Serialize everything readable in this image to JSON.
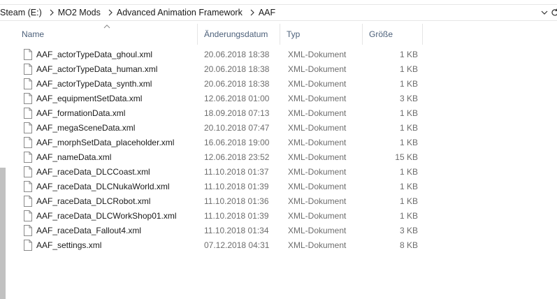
{
  "address_bar": {
    "breadcrumbs": [
      "Steam (E:)",
      "MO2 Mods",
      "Advanced Animation Framework",
      "AAF"
    ],
    "separator_icon": "chevron-right-icon",
    "dropdown_icon": "chevron-down-icon",
    "refresh_icon": "refresh-icon"
  },
  "columns": {
    "name": "Name",
    "date": "Änderungsdatum",
    "type": "Typ",
    "size": "Größe",
    "sort_indicator": "sort-ascending-icon"
  },
  "files": [
    {
      "name": "AAF_actorTypeData_ghoul.xml",
      "date": "20.06.2018 18:38",
      "type": "XML-Dokument",
      "size": "1 KB"
    },
    {
      "name": "AAF_actorTypeData_human.xml",
      "date": "20.06.2018 18:38",
      "type": "XML-Dokument",
      "size": "1 KB"
    },
    {
      "name": "AAF_actorTypeData_synth.xml",
      "date": "20.06.2018 18:38",
      "type": "XML-Dokument",
      "size": "1 KB"
    },
    {
      "name": "AAF_equipmentSetData.xml",
      "date": "12.06.2018 01:00",
      "type": "XML-Dokument",
      "size": "3 KB"
    },
    {
      "name": "AAF_formationData.xml",
      "date": "18.09.2018 07:13",
      "type": "XML-Dokument",
      "size": "1 KB"
    },
    {
      "name": "AAF_megaSceneData.xml",
      "date": "20.10.2018 07:47",
      "type": "XML-Dokument",
      "size": "1 KB"
    },
    {
      "name": "AAF_morphSetData_placeholder.xml",
      "date": "16.06.2018 19:00",
      "type": "XML-Dokument",
      "size": "1 KB"
    },
    {
      "name": "AAF_nameData.xml",
      "date": "12.06.2018 23:52",
      "type": "XML-Dokument",
      "size": "15 KB"
    },
    {
      "name": "AAF_raceData_DLCCoast.xml",
      "date": "11.10.2018 01:37",
      "type": "XML-Dokument",
      "size": "1 KB"
    },
    {
      "name": "AAF_raceData_DLCNukaWorld.xml",
      "date": "11.10.2018 01:39",
      "type": "XML-Dokument",
      "size": "1 KB"
    },
    {
      "name": "AAF_raceData_DLCRobot.xml",
      "date": "11.10.2018 01:36",
      "type": "XML-Dokument",
      "size": "1 KB"
    },
    {
      "name": "AAF_raceData_DLCWorkShop01.xml",
      "date": "11.10.2018 01:39",
      "type": "XML-Dokument",
      "size": "1 KB"
    },
    {
      "name": "AAF_raceData_Fallout4.xml",
      "date": "11.10.2018 01:34",
      "type": "XML-Dokument",
      "size": "3 KB"
    },
    {
      "name": "AAF_settings.xml",
      "date": "07.12.2018 04:31",
      "type": "XML-Dokument",
      "size": "8 KB"
    }
  ],
  "file_icon": "document-icon",
  "colors": {
    "header_text": "#4c607a",
    "meta_text": "#6d6d6d",
    "scroll_thumb": "#c1c1c1"
  }
}
